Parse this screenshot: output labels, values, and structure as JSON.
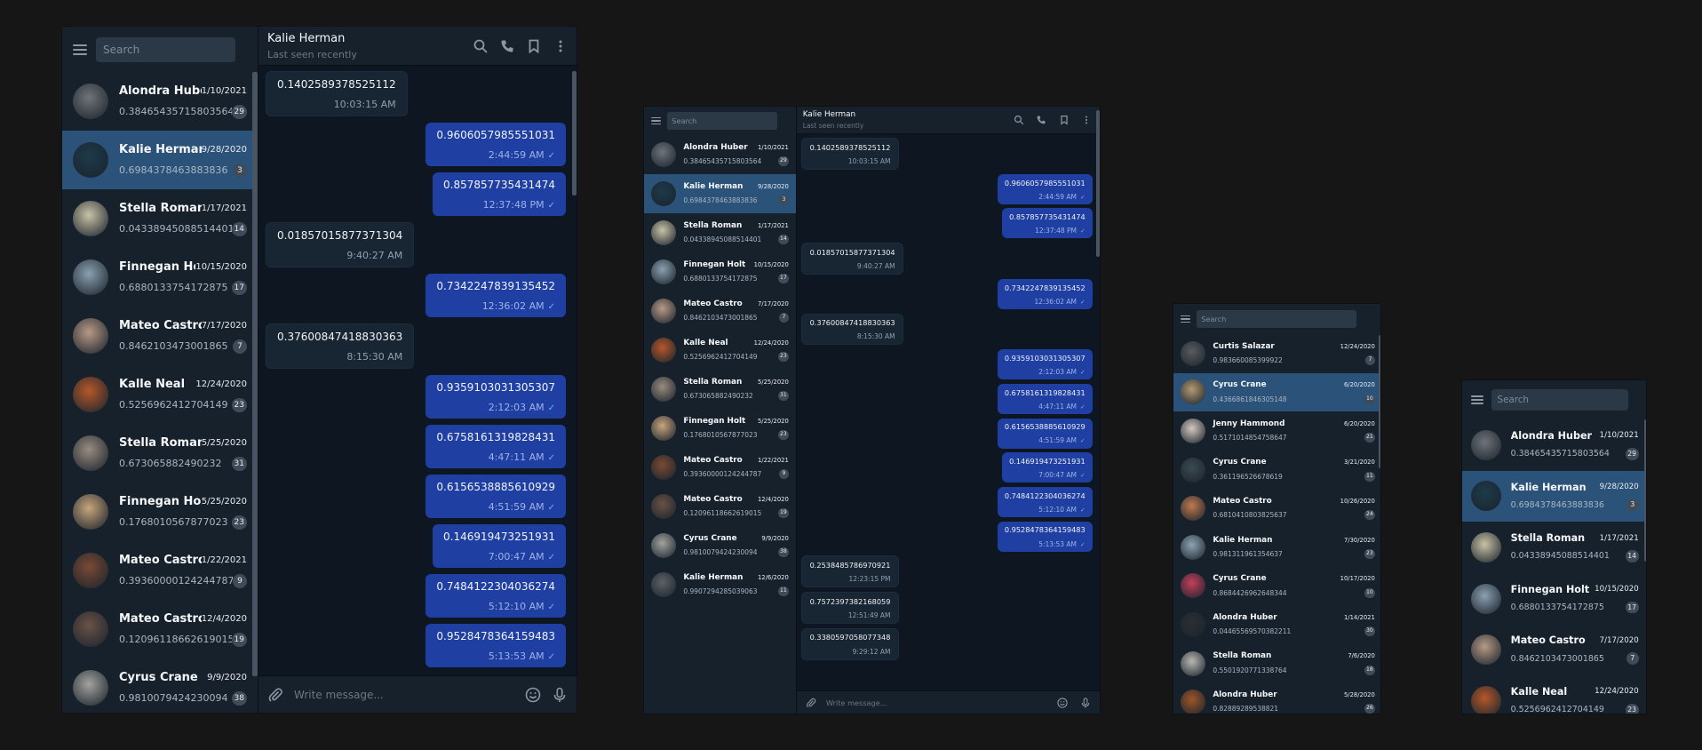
{
  "window": {
    "chat_title": "Kalie Herman",
    "chat_status": "Last seen recently",
    "search_placeholder": "Search",
    "compose_placeholder": "Write message..."
  },
  "icons": {
    "menu": "menu-icon",
    "search": "search-icon",
    "call": "phone-icon",
    "bookmark": "bookmark-icon",
    "more": "more-vertical-icon",
    "attach": "paperclip-icon",
    "emoji": "emoji-icon",
    "mic": "microphone-icon"
  },
  "colors": {
    "background": "#161616",
    "sidebar": "#17212b",
    "chat_bg": "#0e1621",
    "active_item": "#2b5278",
    "outgoing": "#1f3fa3",
    "incoming": "#182533",
    "badge": "#3f4b58"
  },
  "dialogs": [
    {
      "name": "Alondra Huber",
      "date": "1/10/2021",
      "message": "0.38465435715803564",
      "unread": "29",
      "avatar": "#6f7479"
    },
    {
      "name": "Kalie Herman",
      "date": "9/28/2020",
      "message": "0.6984378463883836",
      "unread": "3",
      "avatar": "#1d3a4a"
    },
    {
      "name": "Stella Roman",
      "date": "1/17/2021",
      "message": "0.04338945088514401",
      "unread": "14",
      "avatar": "#c9c2a6"
    },
    {
      "name": "Finnegan Holt",
      "date": "10/15/2020",
      "message": "0.6880133754172875",
      "unread": "17",
      "avatar": "#8aa0b0"
    },
    {
      "name": "Mateo Castro",
      "date": "7/17/2020",
      "message": "0.8462103473001865",
      "unread": "7",
      "avatar": "#b89a86"
    },
    {
      "name": "Kalle Neal",
      "date": "12/24/2020",
      "message": "0.5256962412704149",
      "unread": "23",
      "avatar": "#b5582a"
    },
    {
      "name": "Stella Roman",
      "date": "5/25/2020",
      "message": "0.673065882490232",
      "unread": "31",
      "avatar": "#9a8c80"
    },
    {
      "name": "Finnegan Holt",
      "date": "5/25/2020",
      "message": "0.1768010567877023",
      "unread": "23",
      "avatar": "#c8a57c"
    },
    {
      "name": "Mateo Castro",
      "date": "1/22/2021",
      "message": "0.39360000124244787",
      "unread": "9",
      "avatar": "#7a4a33"
    },
    {
      "name": "Mateo Castro",
      "date": "12/4/2020",
      "message": "0.12096118662619015",
      "unread": "19",
      "avatar": "#6a5246"
    },
    {
      "name": "Cyrus Crane",
      "date": "9/9/2020",
      "message": "0.9810079424230094",
      "unread": "38",
      "avatar": "#a3a39e"
    },
    {
      "name": "Kalie Herman",
      "date": "12/6/2020",
      "message": "0.9907294285039063",
      "unread": "11",
      "avatar": "#5d6166"
    }
  ],
  "dialogs_alt": [
    {
      "name": "Curtis Salazar",
      "date": "12/24/2020",
      "message": "0.983660085399922",
      "unread": "7",
      "avatar": "#5a5c60"
    },
    {
      "name": "Cyrus Crane",
      "date": "6/20/2020",
      "message": "0.4366861846305148",
      "unread": "10",
      "avatar": "#b39a72"
    },
    {
      "name": "Jenny Hammond",
      "date": "6/20/2020",
      "message": "0.5171014854758647",
      "unread": "21",
      "avatar": "#d4c9c0"
    },
    {
      "name": "Cyrus Crane",
      "date": "3/21/2020",
      "message": "0.361196526678619",
      "unread": "11",
      "avatar": "#3a4a52"
    },
    {
      "name": "Mateo Castro",
      "date": "10/26/2020",
      "message": "0.6810410803825637",
      "unread": "24",
      "avatar": "#c07a4e"
    },
    {
      "name": "Kalie Herman",
      "date": "7/30/2020",
      "message": "0.981311961354637",
      "unread": "23",
      "avatar": "#8ea4b4"
    },
    {
      "name": "Cyrus Crane",
      "date": "10/17/2020",
      "message": "0.8684426962648344",
      "unread": "10",
      "avatar": "#c43f5a"
    },
    {
      "name": "Alondra Huber",
      "date": "1/14/2021",
      "message": "0.04465569570382211",
      "unread": "30",
      "avatar": "#2a2f33"
    },
    {
      "name": "Stella Roman",
      "date": "7/6/2020",
      "message": "0.5501920771338764",
      "unread": "18",
      "avatar": "#b8b8b0"
    },
    {
      "name": "Alondra Huber",
      "date": "5/28/2020",
      "message": "0.82889289538821",
      "unread": "26",
      "avatar": "#a0552a"
    }
  ],
  "messages": [
    {
      "dir": "in",
      "text": "0.1402589378525112",
      "time": "10:03:15 AM"
    },
    {
      "dir": "out",
      "text": "0.9606057985551031",
      "time": "2:44:59 AM"
    },
    {
      "dir": "out",
      "text": "0.857857735431474",
      "time": "12:37:48 PM"
    },
    {
      "dir": "in",
      "text": "0.01857015877371304",
      "time": "9:40:27 AM"
    },
    {
      "dir": "out",
      "text": "0.7342247839135452",
      "time": "12:36:02 AM"
    },
    {
      "dir": "in",
      "text": "0.37600847418830363",
      "time": "8:15:30 AM"
    },
    {
      "dir": "out",
      "text": "0.9359103031305307",
      "time": "2:12:03 AM"
    },
    {
      "dir": "out",
      "text": "0.6758161319828431",
      "time": "4:47:11 AM"
    },
    {
      "dir": "out",
      "text": "0.6156538885610929",
      "time": "4:51:59 AM"
    },
    {
      "dir": "out",
      "text": "0.146919473251931",
      "time": "7:00:47 AM"
    },
    {
      "dir": "out",
      "text": "0.7484122304036274",
      "time": "5:12:10 AM"
    },
    {
      "dir": "out",
      "text": "0.9528478364159483",
      "time": "5:13:53 AM"
    },
    {
      "dir": "in",
      "text": "0.2538485786970921",
      "time": "12:23:15 PM"
    },
    {
      "dir": "in",
      "text": "0.7572397382168059",
      "time": "12:51:49 AM"
    },
    {
      "dir": "in",
      "text": "0.3380597058077348",
      "time": "9:29:12 AM"
    }
  ]
}
